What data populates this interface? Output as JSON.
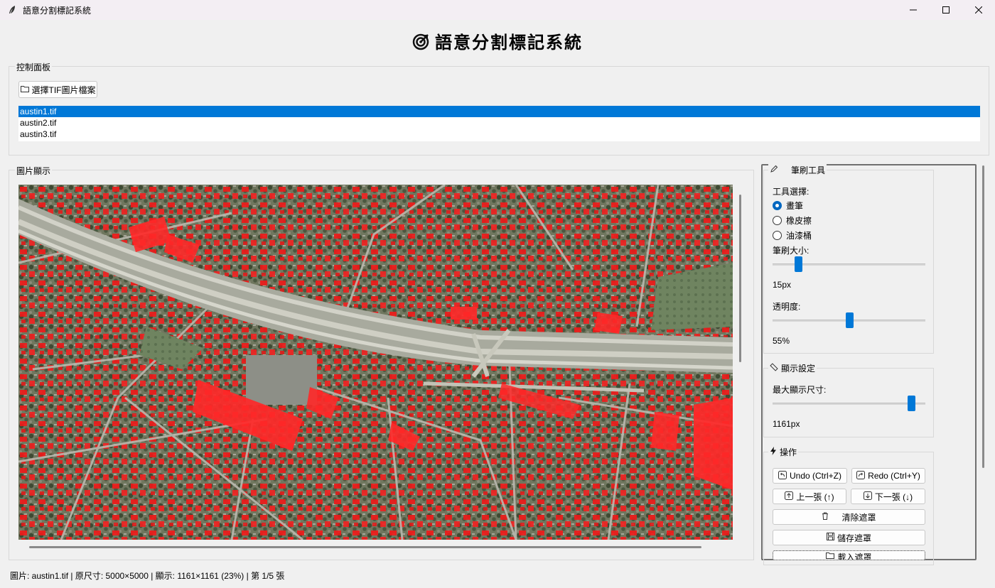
{
  "window": {
    "title": "語意分割標記系統",
    "icon": "feather-icon"
  },
  "header": {
    "title": "語意分割標記系統",
    "icon": "target-icon"
  },
  "control_panel": {
    "label": "控制面板",
    "select_button_label": "選擇TIF圖片檔案",
    "files": [
      "austin1.tif",
      "austin2.tif",
      "austin3.tif"
    ],
    "selected_index": 0
  },
  "image_panel": {
    "label": "圖片顯示",
    "image_description": "aerial satellite view with red building segmentation mask"
  },
  "brush_tools": {
    "label": "筆刷工具",
    "tool_select_label": "工具選擇:",
    "tools": [
      "畫筆",
      "橡皮擦",
      "油漆桶"
    ],
    "selected_tool_index": 0,
    "size_label": "筆刷大小:",
    "size_value": "15px",
    "size_fraction": 0.15,
    "opacity_label": "透明度:",
    "opacity_value": "55%",
    "opacity_fraction": 0.5
  },
  "display_settings": {
    "label": "顯示設定",
    "max_size_label": "最大顯示尺寸:",
    "max_size_value": "1161px",
    "max_size_fraction": 0.93
  },
  "operations": {
    "label": "操作",
    "undo_label": "Undo (Ctrl+Z)",
    "redo_label": "Redo (Ctrl+Y)",
    "prev_label": "上一張 (↑)",
    "next_label": "下一張 (↓)",
    "clear_label": "清除遮罩",
    "save_label": "儲存遮罩",
    "load_label": "載入遮罩"
  },
  "status": {
    "text": "圖片: austin1.tif | 原尺寸: 5000×5000 | 顯示: 1161×1161 (23%) | 第 1/5 張"
  },
  "colors": {
    "accent": "#0078d7",
    "mask": "#ff1e1e"
  }
}
